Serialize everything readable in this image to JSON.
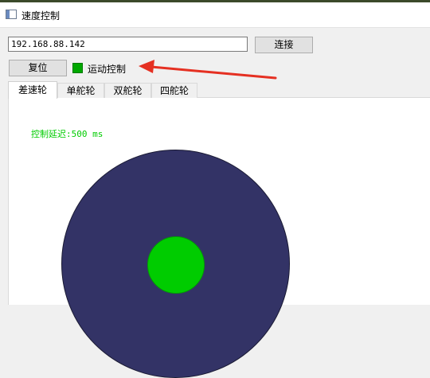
{
  "window": {
    "title": "速度控制"
  },
  "connection": {
    "ip": "192.168.88.142",
    "connect_label": "连接"
  },
  "controls": {
    "reset_label": "复位",
    "motion_label": "运动控制",
    "indicator_color": "#00a800"
  },
  "tabs": [
    {
      "label": "差速轮",
      "active": true
    },
    {
      "label": "单舵轮",
      "active": false
    },
    {
      "label": "双舵轮",
      "active": false
    },
    {
      "label": "四舵轮",
      "active": false
    }
  ],
  "panel": {
    "delay_label": "控制延迟:500 ms",
    "wheel_color": "#333366",
    "dot_color": "#00cc00"
  }
}
